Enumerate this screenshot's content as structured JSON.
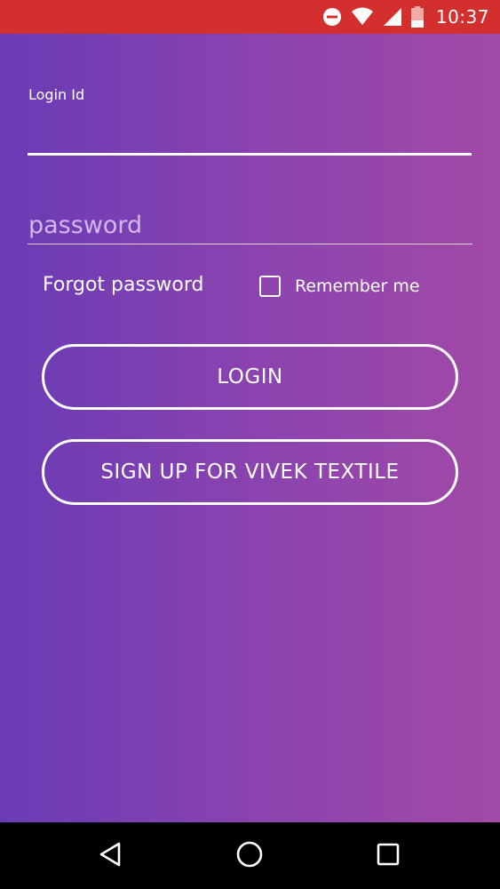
{
  "status_bar": {
    "time": "10:37",
    "icons": [
      "do-not-disturb-icon",
      "wifi-icon",
      "signal-icon",
      "battery-icon"
    ],
    "color": "#d32f2f"
  },
  "form": {
    "login_id_label": "Login Id",
    "login_id_value": "",
    "password_placeholder": "password",
    "password_value": "",
    "forgot_password": "Forgot password",
    "remember_me": "Remember me",
    "remember_checked": false
  },
  "buttons": {
    "login": "LOGIN",
    "signup": "SIGN UP FOR VIVEK TEXTILE"
  },
  "nav_bar": {
    "icons": [
      "back-icon",
      "home-icon",
      "recents-icon"
    ]
  },
  "colors": {
    "gradient_start": "#6a3bb5",
    "gradient_end": "#a24aa7",
    "status_bar": "#d32f2f"
  }
}
